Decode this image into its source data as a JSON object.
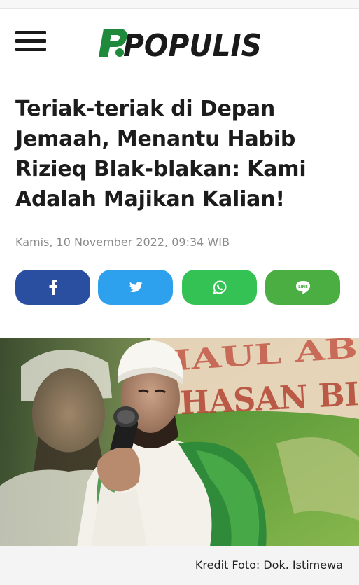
{
  "header": {
    "menu_icon": "hamburger-menu-icon",
    "logo_text": "POPULIS",
    "logo_color": "#1f8a3b"
  },
  "article": {
    "title": "Teriak-teriak di Depan Jemaah, Menantu Habib Rizieq Blak-blakan: Kami Adalah Majikan Kalian!",
    "date": "Kamis, 10 November 2022, 09:34 WIB"
  },
  "share": {
    "buttons": [
      {
        "name": "facebook",
        "icon": "facebook-icon",
        "color": "#2b4fa0"
      },
      {
        "name": "twitter",
        "icon": "twitter-icon",
        "color": "#2ea1ee"
      },
      {
        "name": "whatsapp",
        "icon": "whatsapp-icon",
        "color": "#35c254"
      },
      {
        "name": "line",
        "icon": "line-icon",
        "color": "#4aae43"
      }
    ]
  },
  "photo": {
    "banner_top": "HAUL AB",
    "banner_bottom": "HASAN BI",
    "credit": "Kredit Foto: Dok. Istimewa"
  }
}
